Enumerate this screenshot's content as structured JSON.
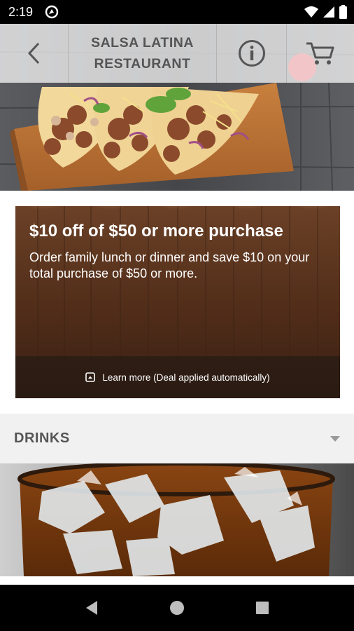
{
  "status_bar": {
    "time": "2:19",
    "icons": [
      "app-notification-icon",
      "wifi-icon",
      "signal-icon",
      "battery-icon"
    ]
  },
  "header": {
    "title_line1": "SALSA LATINA",
    "title_line2": "RESTAURANT",
    "back_icon": "chevron-left-icon",
    "info_icon": "info-icon",
    "cart_icon": "cart-icon"
  },
  "hero": {
    "image": "tacos-photo"
  },
  "deal": {
    "title": "$10 off of $50 or more purchase",
    "description": "Order family lunch or dinner and save $10 on your total purchase of $50 or more.",
    "learn_more": "Learn more (Deal applied automatically)",
    "learn_more_icon": "expand-icon"
  },
  "menu": {
    "section_title": "DRINKS",
    "expand_icon": "caret-down-icon",
    "image": "iced-drink-photo"
  },
  "nav_bar": {
    "icons": [
      "back-triangle-icon",
      "home-circle-icon",
      "recents-square-icon"
    ]
  },
  "colors": {
    "header_text": "#555555",
    "section_bg": "#f1f1f1",
    "deal_wood": "#5a3520"
  }
}
